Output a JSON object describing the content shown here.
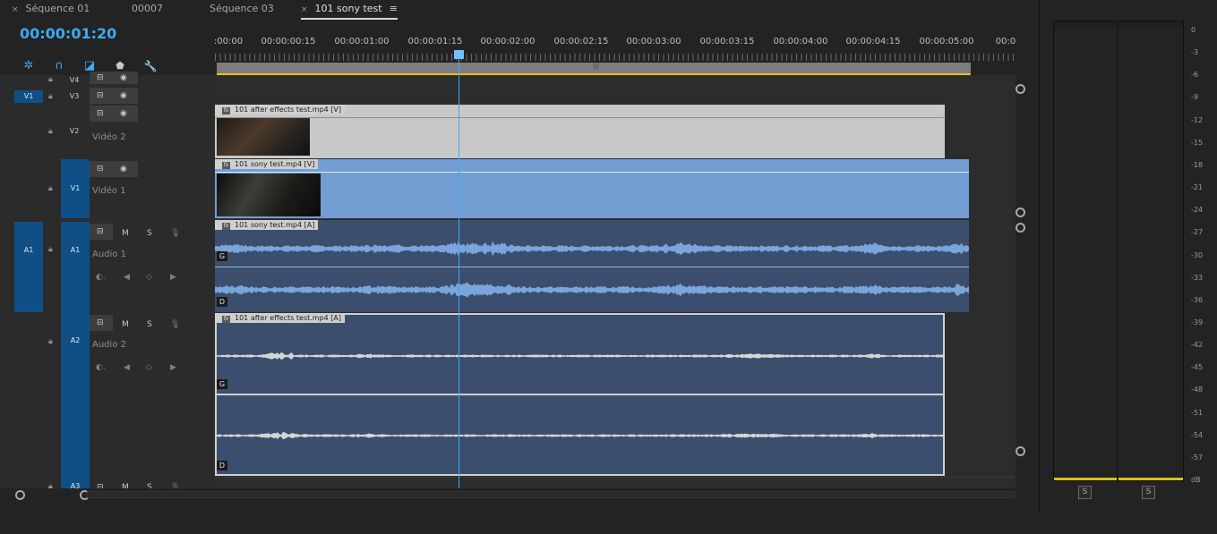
{
  "tabs": [
    {
      "close": "×",
      "label": "Séquence 01"
    },
    {
      "label": "00007"
    },
    {
      "label": "Séquence 03"
    },
    {
      "close": "×",
      "label": "101 sony test",
      "menu": "≡",
      "active": true
    }
  ],
  "timecode": "00:00:01:20",
  "tools": [
    {
      "name": "snap-icon",
      "glyph": "✲",
      "color": "#3fa9f5"
    },
    {
      "name": "linked-selection-icon",
      "glyph": "∩",
      "color": "#3fa9f5"
    },
    {
      "name": "add-marker-icon",
      "glyph": "◪",
      "color": "#3fa9f5"
    },
    {
      "name": "marker-icon",
      "glyph": "⬟",
      "color": "#c8c8c8"
    },
    {
      "name": "wrench-icon",
      "glyph": "🔧",
      "color": "#c8c8c8"
    }
  ],
  "ruler": {
    "ticks": [
      ":00:00",
      "00:00:00:15",
      "00:00:01:00",
      "00:00:01:15",
      "00:00:02:00",
      "00:00:02:15",
      "00:00:03:00",
      "00:00:03:15",
      "00:00:04:00",
      "00:00:04:15",
      "00:00:05:00",
      "00:0"
    ],
    "work_area_grip": "|||"
  },
  "tracks": {
    "v4": {
      "label": "V4"
    },
    "v3": {
      "label": "V3",
      "source": "V1"
    },
    "v2": {
      "label": "V2",
      "name": "Vidéo 2"
    },
    "v1": {
      "label": "V1",
      "name": "Vidéo 1"
    },
    "a1": {
      "label": "A1",
      "source": "A1",
      "name": "Audio 1",
      "mute": "M",
      "solo": "S"
    },
    "a2": {
      "label": "A2",
      "name": "Audio 2",
      "mute": "M",
      "solo": "S"
    },
    "a3": {
      "label": "A3",
      "mute": "M",
      "solo": "S"
    }
  },
  "clips": {
    "v2_clip": {
      "label": "101 after effects test.mp4 [V]",
      "fx": "fx"
    },
    "v1_clip": {
      "label": "101 sony test.mp4 [V]",
      "fx": "fx"
    },
    "a1_clip": {
      "label": "101 sony test.mp4 [A]",
      "fx": "fx",
      "left": "G",
      "right": "D"
    },
    "a2_clip": {
      "label": "101 after effects test.mp4 [A]",
      "fx": "fx",
      "left": "G",
      "right": "D"
    }
  },
  "meter": {
    "db_scale": [
      "0",
      "-3",
      "-6",
      "-9",
      "-12",
      "-15",
      "-18",
      "-21",
      "-24",
      "-27",
      "-30",
      "-33",
      "-36",
      "-39",
      "-42",
      "-45",
      "-48",
      "-51",
      "-54",
      "-57",
      "dB"
    ],
    "solo_left": "S",
    "solo_right": "S"
  },
  "colors": {
    "accent": "#3fa9f5",
    "video_clip_v2": "#c8c8c8",
    "video_clip_v1": "#729ed4",
    "audio_clip": "#3c4e6d",
    "waveform_a1": "#7aa5dc",
    "waveform_a2": "#d5d5d5",
    "track_target": "#0f4f86"
  }
}
